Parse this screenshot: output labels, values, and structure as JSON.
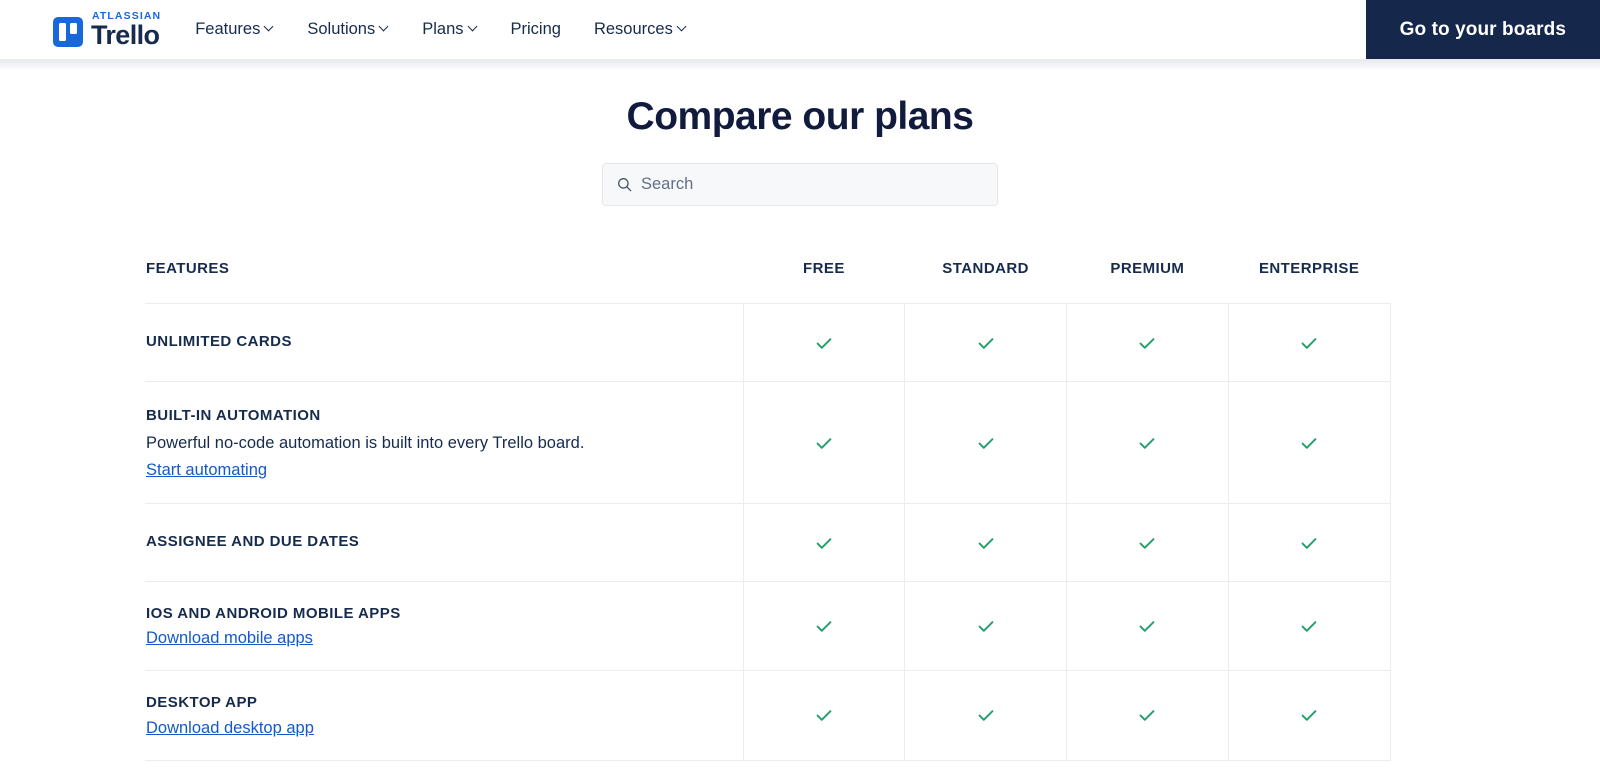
{
  "nav": {
    "logo": {
      "eyebrow": "ATLASSIAN",
      "name": "Trello",
      "icon": "trello-logo-icon"
    },
    "links": [
      {
        "label": "Features",
        "has_menu": true
      },
      {
        "label": "Solutions",
        "has_menu": true
      },
      {
        "label": "Plans",
        "has_menu": true
      },
      {
        "label": "Pricing",
        "has_menu": false
      },
      {
        "label": "Resources",
        "has_menu": true
      }
    ],
    "cta_label": "Go to your boards",
    "cta_color": "#15274B"
  },
  "main": {
    "title": "Compare our plans",
    "search": {
      "value": "",
      "placeholder": "Search",
      "icon": "search-icon"
    }
  },
  "table": {
    "columns": [
      "FEATURES",
      "FREE",
      "STANDARD",
      "PREMIUM",
      "ENTERPRISE"
    ],
    "check_color": "#22A06B",
    "rows": [
      {
        "name": "UNLIMITED CARDS",
        "description": "",
        "link": "",
        "free": "check",
        "standard": "check",
        "premium": "check",
        "enterprise": "check"
      },
      {
        "name": "BUILT-IN AUTOMATION",
        "description": "Powerful no-code automation is built into every Trello board.",
        "link": "Start automating",
        "free": "check",
        "standard": "check",
        "premium": "check",
        "enterprise": "check"
      },
      {
        "name": "ASSIGNEE AND DUE DATES",
        "description": "",
        "link": "",
        "free": "check",
        "standard": "check",
        "premium": "check",
        "enterprise": "check"
      },
      {
        "name": "IOS AND ANDROID MOBILE APPS",
        "description": "",
        "link": "Download mobile apps",
        "free": "check",
        "standard": "check",
        "premium": "check",
        "enterprise": "check"
      },
      {
        "name": "DESKTOP APP",
        "description": "",
        "link": "Download desktop app",
        "free": "check",
        "standard": "check",
        "premium": "check",
        "enterprise": "check"
      }
    ]
  }
}
